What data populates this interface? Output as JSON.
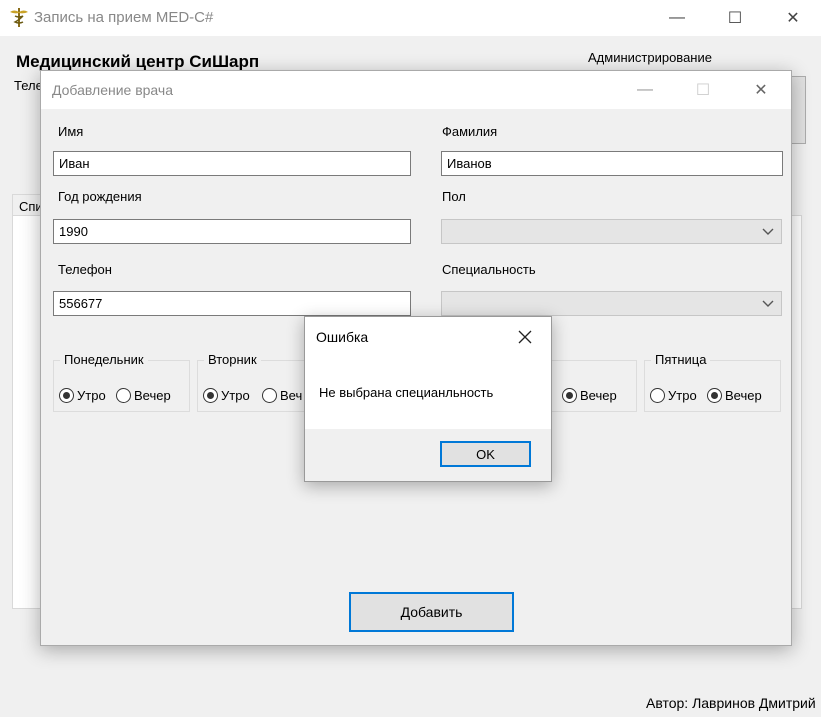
{
  "main_window": {
    "title": "Запись на прием MED-C#",
    "controls": {
      "minimize": "—",
      "maximize": "☐",
      "close": "✕"
    },
    "heading": "Медицинский центр СиШарп",
    "phone_label_partial": "Теле",
    "admin_label": "Администрирование",
    "tab_label_partial": "Спи",
    "author": "Автор: Лавринов Дмитрий"
  },
  "dialog": {
    "title": "Добавление врача",
    "controls": {
      "minimize": "—",
      "maximize": "☐",
      "close": "✕"
    },
    "fields": {
      "first_name": {
        "label": "Имя",
        "value": "Иван"
      },
      "last_name": {
        "label": "Фамилия",
        "value": "Иванов"
      },
      "birth_year": {
        "label": "Год рождения",
        "value": "1990"
      },
      "gender": {
        "label": "Пол",
        "value": ""
      },
      "phone": {
        "label": "Телефон",
        "value": "556677"
      },
      "specialty": {
        "label": "Специальность",
        "value": ""
      }
    },
    "schedule": [
      {
        "day": "Понедельник",
        "morning": "Утро",
        "evening": "Вечер",
        "selected": "morning"
      },
      {
        "day": "Вторник",
        "morning": "Утро",
        "evening": "Веч",
        "selected": "morning"
      },
      {
        "day": "",
        "morning": "",
        "evening": "Вечер",
        "selected": "evening"
      },
      {
        "day": "Пятница",
        "morning": "Утро",
        "evening": "Вечер",
        "selected": "evening"
      }
    ],
    "add_button": "Добавить"
  },
  "message_box": {
    "title": "Ошибка",
    "message": "Не выбрана специанльность",
    "ok_button": "OK",
    "close": "✕"
  },
  "colors": {
    "accent": "#0078d7",
    "window_bg": "#f0f0f0",
    "disabled_combo": "#e5e5e5"
  }
}
